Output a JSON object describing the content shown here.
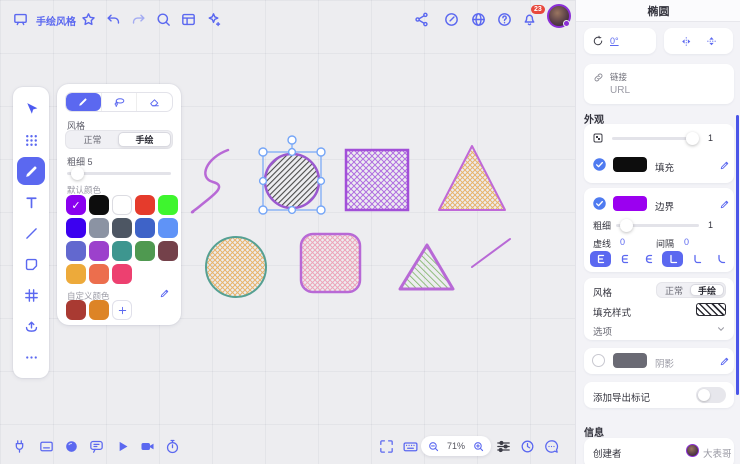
{
  "colors": {
    "accent": "#5b68f0",
    "accent_dark": "#4a55e8",
    "canvas_bg": "#ededf0",
    "panel_bg": "#f3f3f7",
    "badge_red": "#e8473c",
    "selection_blue": "#74a5f7"
  },
  "top_toolbar": {
    "style_label": "手绘风格",
    "icons": [
      "board-icon",
      "star-icon",
      "undo-icon",
      "redo-icon",
      "search-icon",
      "storyboard-icon",
      "magic-icon"
    ]
  },
  "top_right": {
    "notification_count": "23",
    "icons": [
      "share-icon",
      "dashboard-icon",
      "globe-icon",
      "help-icon",
      "bell-icon",
      "avatar"
    ]
  },
  "left_toolbar": {
    "tools": [
      "select",
      "shape-library",
      "pen",
      "text",
      "line",
      "note",
      "frame",
      "upload",
      "more"
    ],
    "active_tool": "pen"
  },
  "pen_panel": {
    "tabs": [
      "pen",
      "lasso",
      "eraser"
    ],
    "active_tab": "pen",
    "style_label": "风格",
    "style_options": [
      "正常",
      "手绘"
    ],
    "style_selected": "手绘",
    "thickness_label": "粗细",
    "thickness_value": "5",
    "default_colors_label": "默认颜色",
    "default_colors": [
      "#8a00ef",
      "#0d0d0d",
      "#ffffff",
      "#e53b2c",
      "#3ef52e",
      "#3c00f0",
      "#8b93a3",
      "#4d5663",
      "#3e63c8",
      "#5f93f7",
      "#6268cf",
      "#9c41cc",
      "#3d968f",
      "#4f9950",
      "#74414a",
      "#edaa3a",
      "#ec6e4d",
      "#ed4070"
    ],
    "selected_color": "#8a00ef",
    "custom_colors_label": "自定义颜色",
    "custom_colors": [
      "#a93a32",
      "#dd8426"
    ]
  },
  "canvas_shapes": [
    {
      "type": "squiggle",
      "stroke": "#b869d6"
    },
    {
      "type": "circle",
      "fill": "dark-hatch",
      "stroke": "#9b59d0",
      "selected": true
    },
    {
      "type": "square",
      "fill": "purple-crosshatch",
      "stroke": "#a24fd8"
    },
    {
      "type": "triangle",
      "fill": "orange-hatch",
      "stroke": "#c069d8"
    },
    {
      "type": "circle",
      "fill": "orange-hatch",
      "stroke": "#55a093"
    },
    {
      "type": "rounded-square",
      "fill": "pink-crosshatch",
      "stroke": "#b869d6"
    },
    {
      "type": "triangle",
      "fill": "green-hatch",
      "stroke": "#b869d6"
    },
    {
      "type": "line",
      "stroke": "#b869d6"
    }
  ],
  "right_panel": {
    "title": "椭圆",
    "rotation_value": "0°",
    "link": {
      "label": "链接",
      "placeholder": "URL"
    },
    "appearance": {
      "section_label": "外观",
      "opacity_value": "1",
      "fill_label": "填充",
      "fill_color": "#0d0d0d",
      "border_label": "边界",
      "border_color": "#9b00f0",
      "thickness_label": "粗细",
      "thickness_value": "1",
      "dash_label": "虚线",
      "dash_value": "0",
      "gap_label": "间隔",
      "gap_value": "0"
    },
    "style_section": {
      "style_label": "风格",
      "style_options": [
        "正常",
        "手绘"
      ],
      "style_selected": "手绘",
      "fill_style_label": "填充样式",
      "options_label": "选项"
    },
    "shadow_label": "阴影",
    "shadow_color": "#6a6a74",
    "export_mark_label": "添加导出标记",
    "info": {
      "section_label": "信息",
      "creator_label": "创建者",
      "creator_name": "大表哥"
    }
  },
  "bottom_toolbar": {
    "left_icons": [
      "plugin-icon",
      "window-icon",
      "sphere-icon",
      "comment-icon",
      "play-icon",
      "record-icon",
      "timer-icon"
    ],
    "right_icons": [
      "fullscreen-icon",
      "keyboard-icon",
      "zoom-out-icon",
      "zoom-in-icon",
      "filters-icon",
      "history-icon",
      "chat-icon"
    ],
    "zoom_value": "71%"
  }
}
